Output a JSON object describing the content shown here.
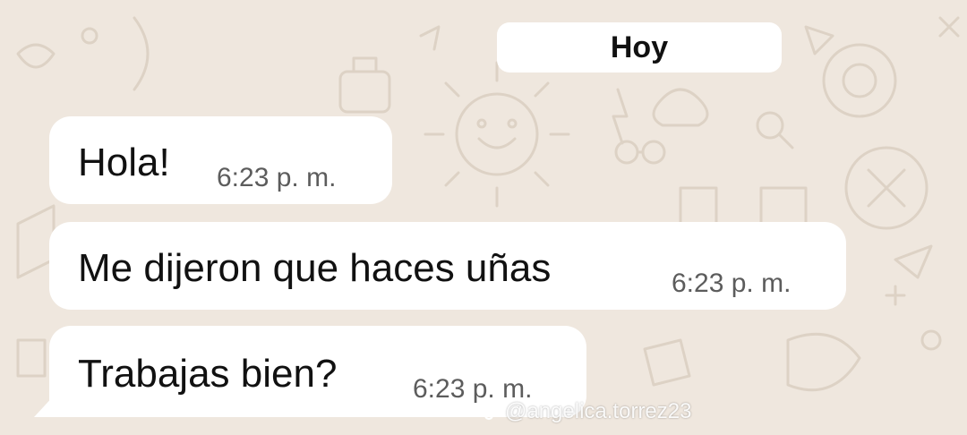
{
  "date_chip": "Hoy",
  "messages": [
    {
      "text": "Hola!",
      "time": "6:23 p. m."
    },
    {
      "text": "Me dijeron que haces uñas",
      "time": "6:23 p. m."
    },
    {
      "text": "Trabajas bien?",
      "time": "6:23 p. m."
    }
  ],
  "watermark": {
    "handle": "@angelica.torrez23",
    "icon": "tiktok-icon"
  },
  "colors": {
    "background": "#efe7de",
    "bubble": "#ffffff",
    "text": "#111111",
    "timestamp": "#5c5c5c"
  }
}
